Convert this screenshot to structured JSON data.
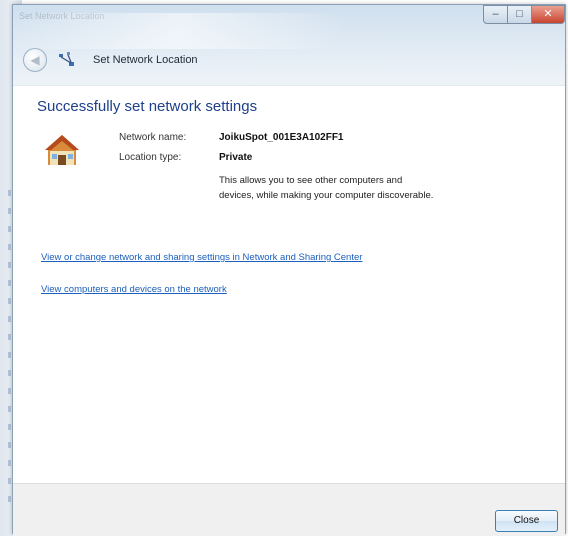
{
  "window": {
    "caption": "Set Network Location",
    "nav_title": "Set Network Location",
    "controls": {
      "minimize": "–",
      "maximize": "□",
      "close": "✕"
    },
    "back_glyph": "◀"
  },
  "content": {
    "heading": "Successfully set network settings",
    "network_name_label": "Network name:",
    "network_name_value": "JoikuSpot_001E3A102FF1",
    "location_type_label": "Location type:",
    "location_type_value": "Private",
    "description": "This allows you to see other computers and devices, while making your computer discoverable.",
    "links": [
      "View or change network and sharing settings in Network and Sharing Center",
      "View computers and devices on the network"
    ]
  },
  "footer": {
    "close_label": "Close"
  },
  "icons": {
    "back": "back-arrow-icon",
    "network": "network-icon",
    "location": "home-icon"
  },
  "colors": {
    "heading": "#1e3f8a",
    "link": "#1b5fbf",
    "close_button": "#c8442f"
  }
}
